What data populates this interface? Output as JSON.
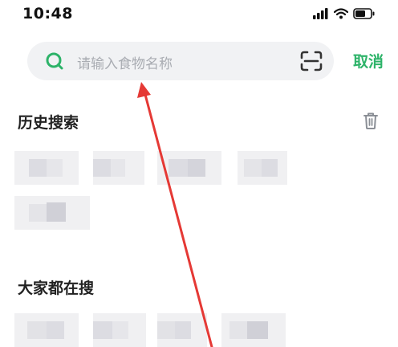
{
  "status_bar": {
    "time": "10:48",
    "icons": [
      "signal-icon",
      "wifi-icon",
      "battery-icon"
    ]
  },
  "search": {
    "placeholder": "请输入食物名称",
    "cancel_label": "取消",
    "icons": [
      "search-icon",
      "scan-icon"
    ]
  },
  "history": {
    "title": "历史搜索",
    "icons": [
      "trash-icon"
    ]
  },
  "popular": {
    "title": "大家都在搜"
  },
  "colors": {
    "accent": "#2db369",
    "annotation_arrow": "#e53935",
    "search_bg": "#f1f2f4"
  }
}
